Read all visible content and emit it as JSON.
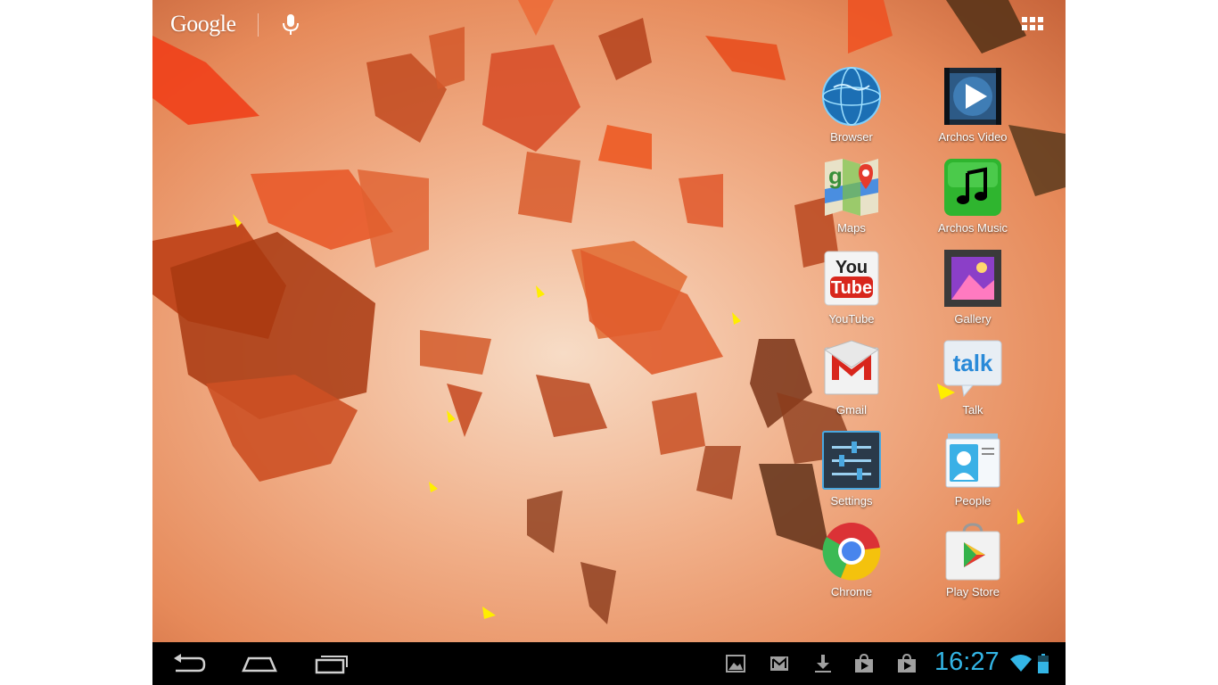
{
  "search": {
    "logo": "Google",
    "mic": "mic-icon"
  },
  "apps_drawer": {
    "icon": "apps-grid-icon"
  },
  "apps": [
    {
      "label": "Browser",
      "icon": "browser-globe-icon"
    },
    {
      "label": "Archos Video",
      "icon": "archos-video-icon"
    },
    {
      "label": "Maps",
      "icon": "maps-icon"
    },
    {
      "label": "Archos Music",
      "icon": "archos-music-icon"
    },
    {
      "label": "YouTube",
      "icon": "youtube-icon",
      "icon_text": [
        "You",
        "Tube"
      ]
    },
    {
      "label": "Gallery",
      "icon": "gallery-icon"
    },
    {
      "label": "Gmail",
      "icon": "gmail-icon"
    },
    {
      "label": "Talk",
      "icon": "talk-icon",
      "icon_text": "talk"
    },
    {
      "label": "Settings",
      "icon": "settings-icon"
    },
    {
      "label": "People",
      "icon": "people-icon"
    },
    {
      "label": "Chrome",
      "icon": "chrome-icon"
    },
    {
      "label": "Play Store",
      "icon": "play-store-icon"
    }
  ],
  "navbar": {
    "buttons": [
      "back-icon",
      "home-icon",
      "recent-apps-icon"
    ],
    "notifications": [
      "screenshot-image-icon",
      "gmail-notification-icon",
      "download-icon",
      "market-update-icon",
      "market-update-icon"
    ],
    "clock": "16:27",
    "wifi": "wifi-icon",
    "battery": "battery-icon"
  },
  "colors": {
    "clock": "#33b5e5",
    "navbar": "#000000",
    "accent_orange": "#e8501c"
  }
}
